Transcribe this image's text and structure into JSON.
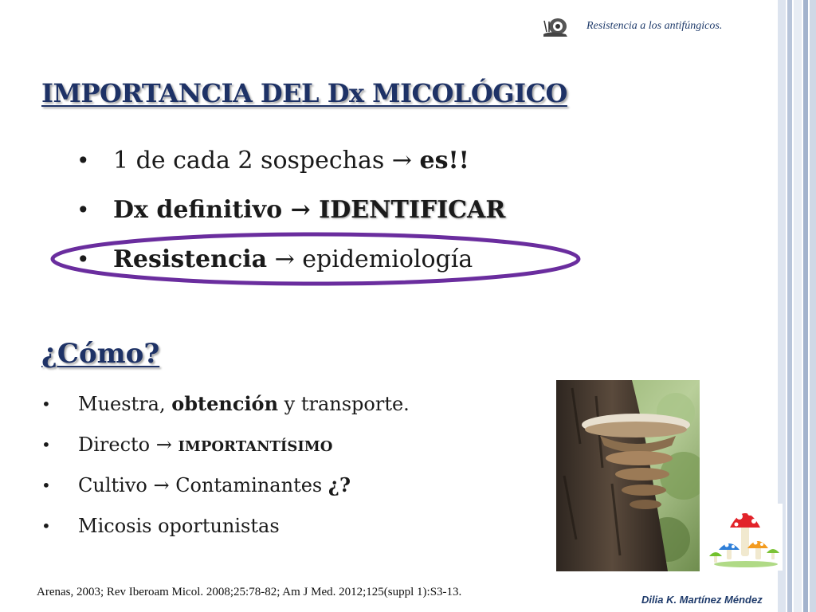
{
  "header": {
    "logo_icon": "snail-logo-icon",
    "subtitle": "Resistencia a los antifúngicos."
  },
  "title": "IMPORTANCIA DEL Dx MICOLÓGICO",
  "bullets": [
    {
      "part1": "1 de cada 2 sospechas → ",
      "part2": "es!!"
    },
    {
      "part1": "Dx definitivo → ",
      "part2": "IDENTIFICAR"
    },
    {
      "part1": "Resistencia",
      "part2": " → epidemiología"
    }
  ],
  "highlight_color": "#6a2d9e",
  "como": {
    "heading": "¿Cómo?",
    "items": [
      {
        "a": "Muestra, ",
        "b": "obtención",
        "c": " y transporte."
      },
      {
        "a": "Directo → ",
        "b": "IMPORTANTÍSIMO",
        "c": ""
      },
      {
        "a": "Cultivo → Contaminantes ",
        "b": "¿?",
        "c": ""
      },
      {
        "a": "Micosis oportunistas",
        "b": "",
        "c": ""
      }
    ]
  },
  "images": {
    "photo": "bracket-fungus-photo",
    "clipart": "mushrooms-clipart-icon"
  },
  "citation": "Arenas, 2003; Rev Iberoam Micol. 2008;25:78-82; Am J Med. 2012;125(suppl 1):S3-13.",
  "author": "Dilia K. Martínez Méndez",
  "colors": {
    "title": "#1e3266",
    "stripes": [
      "#d9e1ee",
      "#b5c3d9",
      "#e6ebf3",
      "#9fb0cc"
    ]
  }
}
